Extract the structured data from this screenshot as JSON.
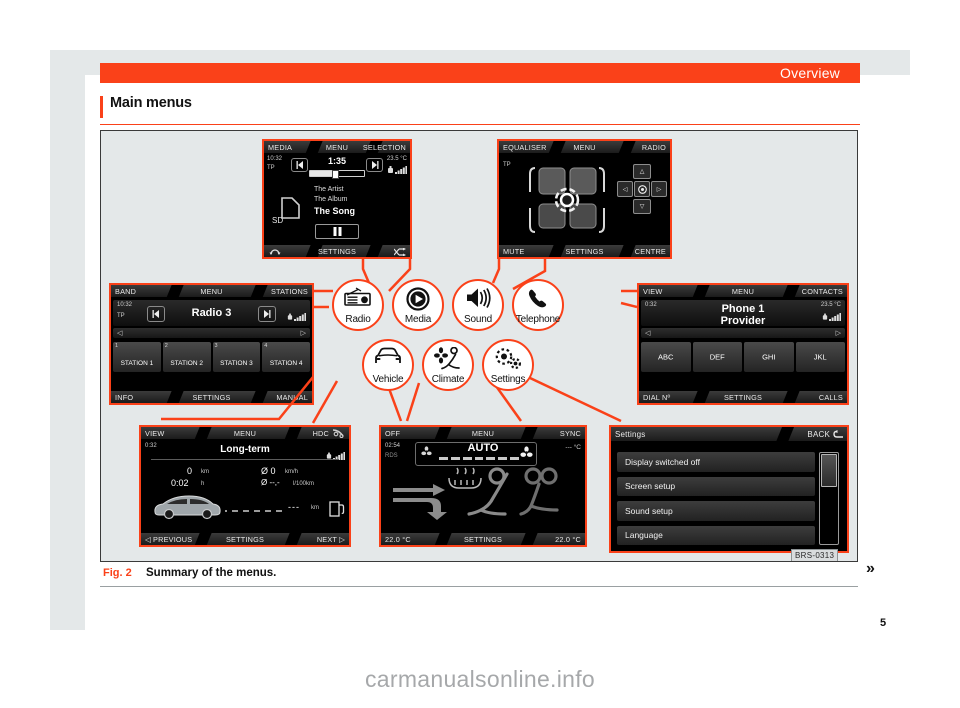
{
  "header": {
    "title": "Overview"
  },
  "section": {
    "title": "Main menus"
  },
  "figure": {
    "number": "Fig. 2",
    "caption": "Summary of the menus.",
    "code": "BRS-0313",
    "chevron": "»",
    "page_number": "5"
  },
  "watermark": "carmanualsonline.info",
  "icons": [
    {
      "id": "radio",
      "label": "Radio",
      "glyph": "radio-icon"
    },
    {
      "id": "media",
      "label": "Media",
      "glyph": "play-circle-icon"
    },
    {
      "id": "sound",
      "label": "Sound",
      "glyph": "speaker-icon"
    },
    {
      "id": "telephone",
      "label": "Telephone",
      "glyph": "phone-handset-icon"
    },
    {
      "id": "vehicle",
      "label": "Vehicle",
      "glyph": "car-front-icon"
    },
    {
      "id": "climate",
      "label": "Climate",
      "glyph": "fan-seat-icon"
    },
    {
      "id": "settings",
      "label": "Settings",
      "glyph": "gears-icon"
    }
  ],
  "screens": {
    "media": {
      "top": {
        "left": "MEDIA",
        "center": "MENU",
        "right": "SELECTION"
      },
      "bottom": {
        "left": "repeat-icon",
        "center": "SETTINGS",
        "right": "shuffle-icon"
      },
      "time": "10:32",
      "tp": "TP",
      "track_time": "1:35",
      "temperature": "23.5 °C",
      "source": "SD",
      "artist": "The Artist",
      "album": "The Album",
      "song": "The Song"
    },
    "equaliser": {
      "top": {
        "left": "EQUALISER",
        "center": "MENU",
        "right": "RADIO"
      },
      "bottom": {
        "left": "MUTE",
        "center": "SETTINGS",
        "right": "CENTRE"
      },
      "tp": "TP"
    },
    "radio": {
      "top": {
        "left": "BAND",
        "center": "MENU",
        "right": "STATIONS"
      },
      "bottom": {
        "left": "INFO",
        "center": "SETTINGS",
        "right": "MANUAL"
      },
      "time": "10:32",
      "tp": "TP",
      "station": "Radio 3",
      "presets": [
        {
          "num": "1",
          "name": "STATION 1"
        },
        {
          "num": "2",
          "name": "STATION 2"
        },
        {
          "num": "3",
          "name": "STATION 3"
        },
        {
          "num": "4",
          "name": "STATION 4"
        }
      ]
    },
    "telephone": {
      "top": {
        "left": "VIEW",
        "center": "MENU",
        "right": "CONTACTS"
      },
      "bottom": {
        "left": "DIAL Nº",
        "center": "SETTINGS",
        "right": "CALLS"
      },
      "time": "0:32",
      "title": "Phone 1",
      "subtitle": "Provider",
      "temperature": "23.5 °C",
      "groups": [
        "ABC",
        "DEF",
        "GHI",
        "JKL"
      ]
    },
    "vehicle": {
      "top": {
        "left": "VIEW",
        "center": "MENU",
        "right": "HDC"
      },
      "bottom": {
        "left": "◁ PREVIOUS",
        "center": "SETTINGS",
        "right": "NEXT ▷"
      },
      "time": "0:32",
      "title": "Long-term",
      "distance_value": "0",
      "distance_unit": "km",
      "duration_value": "0:02",
      "duration_unit": "h",
      "avg_speed_value": "Ø 0",
      "avg_speed_unit": "km/h",
      "avg_consumption_value": "Ø --,-",
      "avg_consumption_unit": "l/100km",
      "range_value": "---",
      "range_unit": "km"
    },
    "climate": {
      "top": {
        "left": "OFF",
        "center": "MENU",
        "right": "SYNC"
      },
      "bottom": {
        "left": "22.0 °C",
        "center": "SETTINGS",
        "right": "22.0 °C"
      },
      "time": "02:54",
      "rds": "RDS",
      "mode": "AUTO",
      "temperature": "--- °C"
    },
    "settings": {
      "top": {
        "left": "Settings",
        "right": "BACK"
      },
      "items": [
        "Display switched off",
        "Screen setup",
        "Sound setup",
        "Language"
      ]
    }
  },
  "colors": {
    "accent": "#fa4119",
    "panel": "#e4e8e9",
    "screen_bg": "#000000"
  }
}
